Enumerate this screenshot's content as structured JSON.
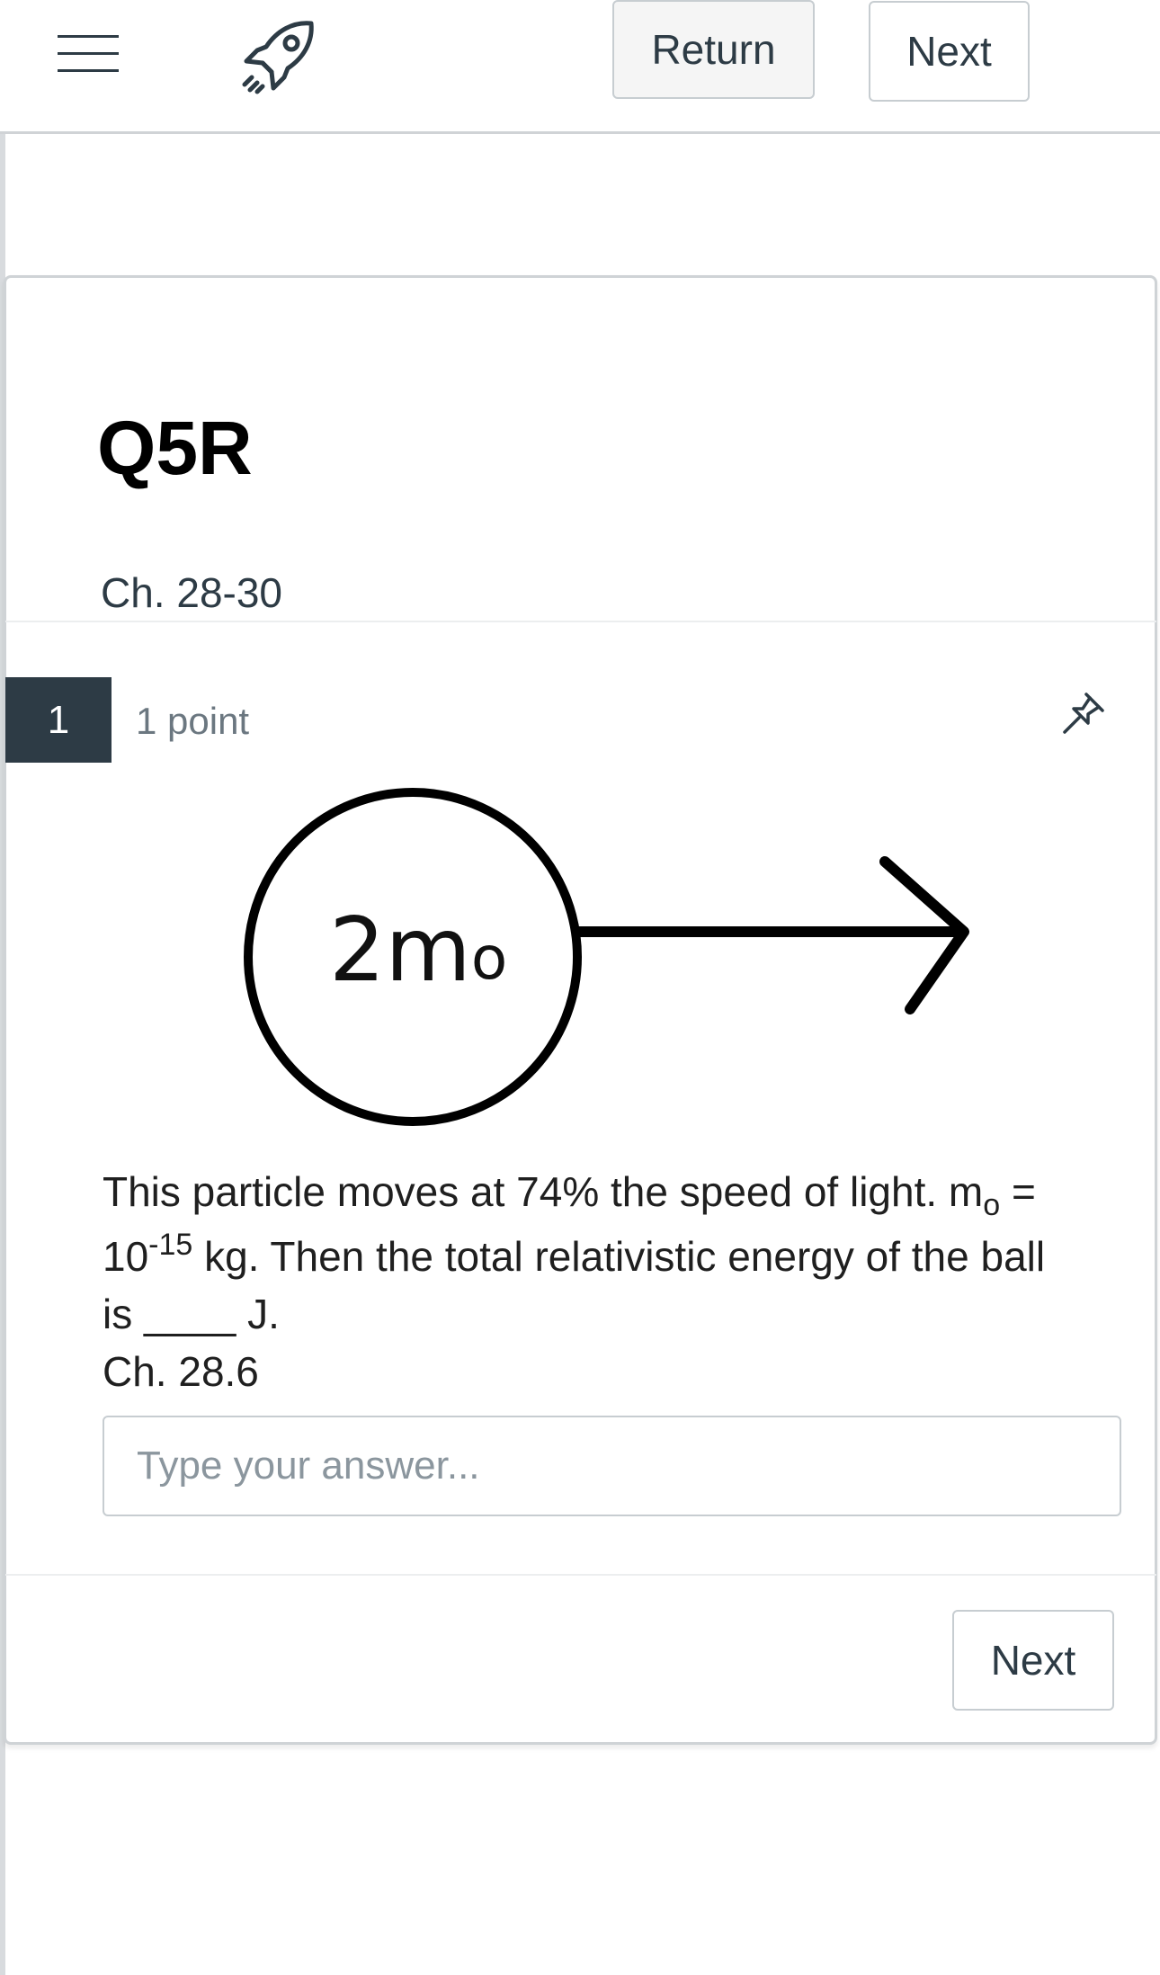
{
  "header": {
    "menu_icon": "hamburger-menu-icon",
    "rocket_icon": "rocket-icon",
    "return_label": "Return",
    "next_label": "Next"
  },
  "quiz": {
    "title": "Q5R",
    "subtitle": "Ch. 28-30"
  },
  "question": {
    "number": "1",
    "points": "1 point",
    "pin_icon": "pin-icon",
    "figure_label_main": "2m",
    "figure_label_sub": "o",
    "text_part1": "This particle moves at 74% the speed of light.  m",
    "text_sub": "o",
    "text_part2": " =",
    "text_line2_base": "10",
    "text_line2_sup": "-15",
    "text_line2_rest": " kg.  Then the total relativistic energy of the ball",
    "text_line3": "is ____ J.",
    "reference": "Ch. 28.6",
    "answer_value": "",
    "answer_placeholder": "Type your answer..."
  },
  "footer": {
    "next_label": "Next"
  }
}
